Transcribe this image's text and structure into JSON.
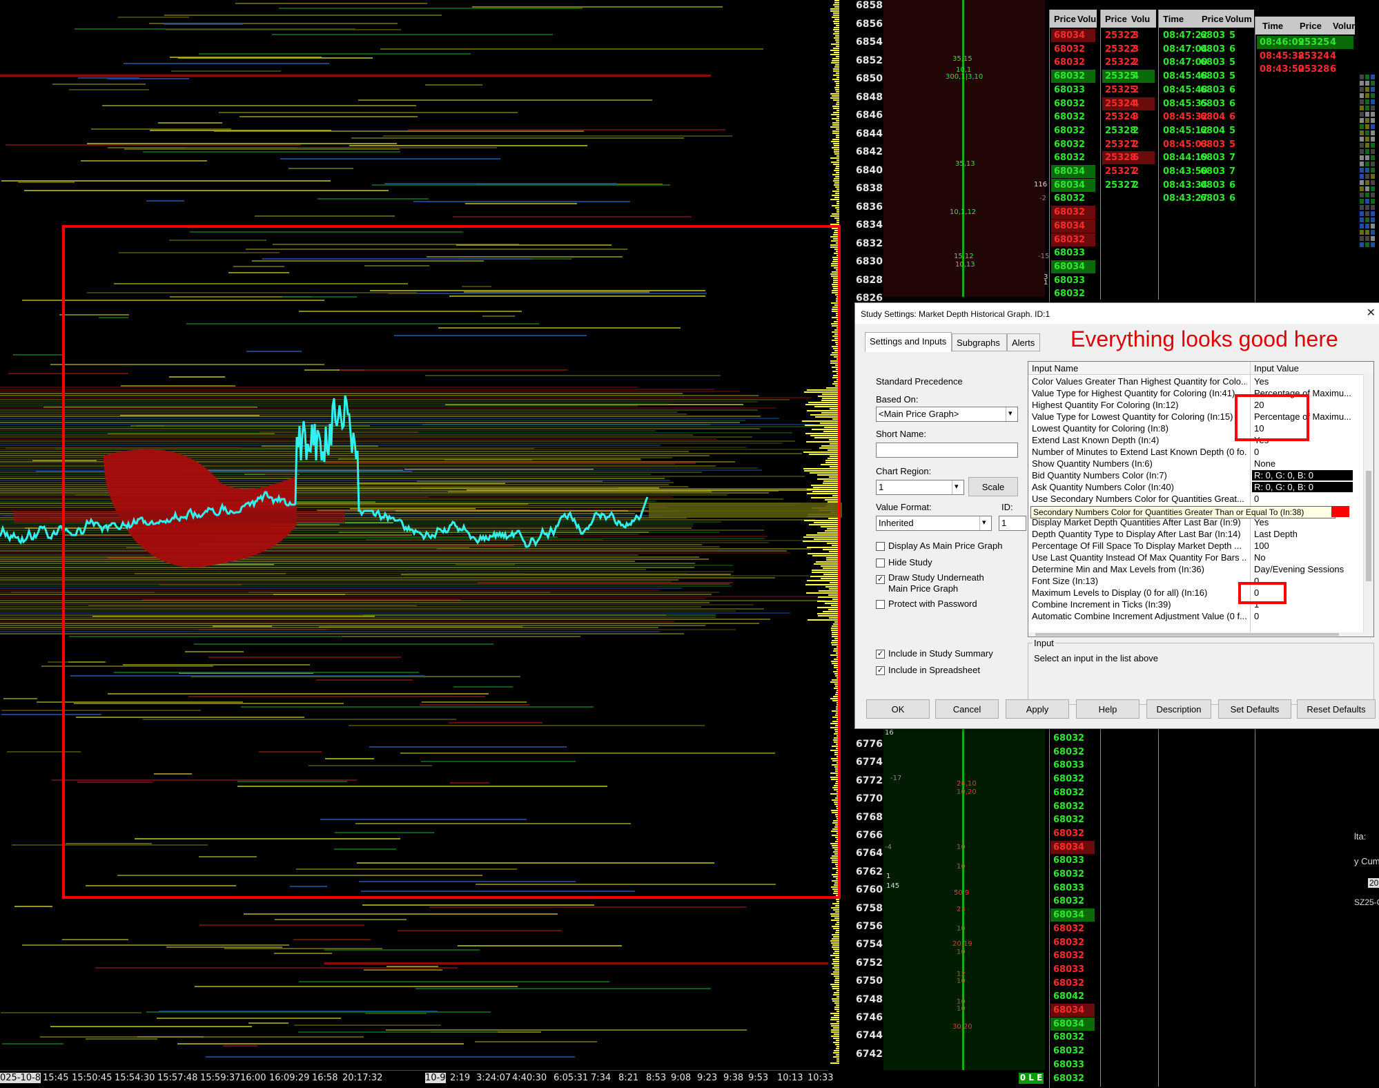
{
  "price_axis": {
    "labels": [
      "6858",
      "6856",
      "6854",
      "6852",
      "6850",
      "6848",
      "6846",
      "6844",
      "6842",
      "6840",
      "6838",
      "6836",
      "6834",
      "6832",
      "6830",
      "6828",
      "6826",
      "6776",
      "6774",
      "6772",
      "6770",
      "6768",
      "6766",
      "6764",
      "6762",
      "6760",
      "6758",
      "6756",
      "6754",
      "6752",
      "6750",
      "6748",
      "6746",
      "6744",
      "6742"
    ]
  },
  "time_axis": {
    "labels": [
      "025-10-8",
      "15:45",
      "15:50:45",
      "15:54:30",
      "15:57:48",
      "15:59:37",
      "16:00",
      "16:09:29",
      "16:58",
      "20:17:32",
      "10-9",
      "2:19",
      "3:24:07",
      "4:40:30",
      "6:05:31",
      "7:34",
      "8:21",
      "8:53",
      "9:08",
      "9:23",
      "9:38",
      "9:53",
      "10:13",
      "10:33"
    ],
    "status": "0 L E"
  },
  "volume_annotations": {
    "items": [
      "35,15",
      "10,1",
      "300,1|3,10",
      "35,13",
      "116",
      "10,1,12",
      "15,12",
      "10,13",
      "-15",
      "3",
      "1",
      "-17",
      "28,10",
      "10,20",
      "16",
      "-4",
      "10",
      "10",
      "50,9",
      "23",
      "10",
      "20,19",
      "10",
      "12",
      "10",
      "10",
      "10",
      "30,20",
      "145",
      "-2",
      "1"
    ]
  },
  "time_and_sales": [
    {
      "headers": [
        "Price",
        "Volu"
      ],
      "rows": [
        {
          "price": "6803",
          "vol": "4",
          "dir": "dn"
        },
        {
          "price": "6803",
          "vol": "2",
          "dir": "dn"
        },
        {
          "price": "6803",
          "vol": "2",
          "dir": "dn"
        },
        {
          "price": "6803",
          "vol": "2",
          "dir": "up"
        },
        {
          "price": "6803",
          "vol": "3",
          "dir": "up"
        },
        {
          "price": "6803",
          "vol": "2",
          "dir": "up"
        },
        {
          "price": "6803",
          "vol": "2",
          "dir": "up"
        },
        {
          "price": "6803",
          "vol": "2",
          "dir": "up"
        },
        {
          "price": "6803",
          "vol": "2",
          "dir": "up"
        },
        {
          "price": "6803",
          "vol": "2",
          "dir": "up"
        },
        {
          "price": "6803",
          "vol": "4",
          "dir": "up"
        },
        {
          "price": "6803",
          "vol": "4",
          "dir": "up"
        },
        {
          "price": "6803",
          "vol": "2",
          "dir": "up"
        },
        {
          "price": "6803",
          "vol": "2",
          "dir": "dn"
        },
        {
          "price": "6803",
          "vol": "4",
          "dir": "dn"
        },
        {
          "price": "6803",
          "vol": "2",
          "dir": "dn"
        },
        {
          "price": "6803",
          "vol": "3",
          "dir": "up"
        },
        {
          "price": "6803",
          "vol": "4",
          "dir": "up"
        },
        {
          "price": "6803",
          "vol": "3",
          "dir": "up"
        },
        {
          "price": "6803",
          "vol": "2",
          "dir": "up"
        }
      ]
    },
    {
      "headers": [
        "Price",
        "Volu"
      ],
      "rows": [
        {
          "price": "25322",
          "vol": "3",
          "dir": "dn"
        },
        {
          "price": "25322",
          "vol": "3",
          "dir": "dn"
        },
        {
          "price": "25322",
          "vol": "2",
          "dir": "dn"
        },
        {
          "price": "25325",
          "vol": "4",
          "dir": "up"
        },
        {
          "price": "25325",
          "vol": "2",
          "dir": "dn"
        },
        {
          "price": "25324",
          "vol": "4",
          "dir": "dn"
        },
        {
          "price": "25324",
          "vol": "3",
          "dir": "dn"
        },
        {
          "price": "25328",
          "vol": "2",
          "dir": "up"
        },
        {
          "price": "25327",
          "vol": "2",
          "dir": "dn"
        },
        {
          "price": "25328",
          "vol": "6",
          "dir": "dn"
        },
        {
          "price": "25327",
          "vol": "2",
          "dir": "dn"
        },
        {
          "price": "25327",
          "vol": "2",
          "dir": "up"
        }
      ]
    },
    {
      "headers": [
        "Time",
        "Price",
        "Volum"
      ],
      "rows": [
        {
          "time": "08:47:22",
          "price": "6803",
          "vol": "5",
          "dir": "up"
        },
        {
          "time": "08:47:04",
          "price": "6803",
          "vol": "6",
          "dir": "up"
        },
        {
          "time": "08:47:00",
          "price": "6803",
          "vol": "5",
          "dir": "up"
        },
        {
          "time": "08:45:48",
          "price": "6803",
          "vol": "5",
          "dir": "up"
        },
        {
          "time": "08:45:48",
          "price": "6803",
          "vol": "6",
          "dir": "up"
        },
        {
          "time": "08:45:35",
          "price": "6803",
          "vol": "6",
          "dir": "up"
        },
        {
          "time": "08:45:32",
          "price": "6804",
          "vol": "6",
          "dir": "dn"
        },
        {
          "time": "08:45:12",
          "price": "6804",
          "vol": "5",
          "dir": "up"
        },
        {
          "time": "08:45:03",
          "price": "6803",
          "vol": "5",
          "dir": "dn"
        },
        {
          "time": "08:44:19",
          "price": "6803",
          "vol": "7",
          "dir": "up"
        },
        {
          "time": "08:43:50",
          "price": "6803",
          "vol": "7",
          "dir": "up"
        },
        {
          "time": "08:43:34",
          "price": "6803",
          "vol": "6",
          "dir": "up"
        },
        {
          "time": "08:43:27",
          "price": "6803",
          "vol": "6",
          "dir": "up"
        }
      ]
    },
    {
      "headers": [
        "Time",
        "Price",
        "Volum"
      ],
      "rows": [
        {
          "time": "08:46:09",
          "price": "25325",
          "vol": "4",
          "dir": "up"
        },
        {
          "time": "08:45:38",
          "price": "25324",
          "vol": "4",
          "dir": "dn"
        },
        {
          "time": "08:43:50",
          "price": "25328",
          "vol": "6",
          "dir": "dn"
        }
      ]
    }
  ],
  "ladder_lower": [
    {
      "price": "6803",
      "vol": "2",
      "dir": "up"
    },
    {
      "price": "6803",
      "vol": "2",
      "dir": "up"
    },
    {
      "price": "6803",
      "vol": "3",
      "dir": "up"
    },
    {
      "price": "6803",
      "vol": "2",
      "dir": "up"
    },
    {
      "price": "6803",
      "vol": "2",
      "dir": "up"
    },
    {
      "price": "6803",
      "vol": "2",
      "dir": "up"
    },
    {
      "price": "6803",
      "vol": "2",
      "dir": "up"
    },
    {
      "price": "6803",
      "vol": "2",
      "dir": "dn"
    },
    {
      "price": "6803",
      "vol": "4",
      "dir": "dn"
    },
    {
      "price": "6803",
      "vol": "3",
      "dir": "up"
    },
    {
      "price": "6803",
      "vol": "2",
      "dir": "up"
    },
    {
      "price": "6803",
      "vol": "3",
      "dir": "up"
    },
    {
      "price": "6803",
      "vol": "2",
      "dir": "up"
    },
    {
      "price": "6803",
      "vol": "4",
      "dir": "up"
    },
    {
      "price": "6803",
      "vol": "2",
      "dir": "dn"
    },
    {
      "price": "6803",
      "vol": "2",
      "dir": "dn"
    },
    {
      "price": "6803",
      "vol": "2",
      "dir": "dn"
    },
    {
      "price": "6803",
      "vol": "3",
      "dir": "dn"
    },
    {
      "price": "6803",
      "vol": "2",
      "dir": "dn"
    },
    {
      "price": "6804",
      "vol": "2",
      "dir": "up"
    },
    {
      "price": "6803",
      "vol": "4",
      "dir": "dn"
    },
    {
      "price": "6803",
      "vol": "4",
      "dir": "up"
    },
    {
      "price": "6803",
      "vol": "2",
      "dir": "up"
    },
    {
      "price": "6803",
      "vol": "2",
      "dir": "up"
    },
    {
      "price": "6803",
      "vol": "3",
      "dir": "up"
    },
    {
      "price": "6803",
      "vol": "2",
      "dir": "up"
    }
  ],
  "side_fragments": {
    "a": "lta:",
    "b": "y Cum",
    "c": "20",
    "d": "SZ25-C"
  },
  "dialog": {
    "title": "Study Settings: Market Depth Historical Graph. ID:1",
    "close": "✕",
    "tabs": [
      "Settings and Inputs",
      "Subgraphs",
      "Alerts"
    ],
    "annotation": "Everything looks good here",
    "standard_precedence": "Standard Precedence",
    "based_on_label": "Based On:",
    "based_on_value": "<Main Price Graph>",
    "short_name_label": "Short Name:",
    "short_name_value": "",
    "chart_region_label": "Chart Region:",
    "chart_region_value": "1",
    "scale_button": "Scale",
    "value_format_label": "Value Format:",
    "value_format_value": "Inherited",
    "id_label": "ID:",
    "id_value": "1",
    "checkboxes": [
      {
        "label": "Display As Main Price Graph",
        "checked": false
      },
      {
        "label": "Hide Study",
        "checked": false
      },
      {
        "label": "Draw Study Underneath",
        "label2": "Main Price Graph",
        "checked": true
      },
      {
        "label": "Protect with Password",
        "checked": false
      }
    ],
    "summary_checkboxes": [
      {
        "label": "Include in Study Summary",
        "checked": true
      },
      {
        "label": "Include in Spreadsheet",
        "checked": true
      }
    ],
    "grid_headers": [
      "Input Name",
      "Input Value"
    ],
    "inputs": [
      {
        "name": "Color Values Greater Than Highest Quantity for Colo...",
        "value": "Yes"
      },
      {
        "name": "Value Type for Highest Quantity for Coloring  (In:41)",
        "value": "Percentage of Maximu..."
      },
      {
        "name": "Highest Quantity For Coloring  (In:12)",
        "value": "20"
      },
      {
        "name": "Value Type for Lowest Quantity for Coloring  (In:15)",
        "value": "Percentage of Maximu..."
      },
      {
        "name": "Lowest Quantity for Coloring  (In:8)",
        "value": "10"
      },
      {
        "name": "Extend Last Known Depth  (In:4)",
        "value": "Yes"
      },
      {
        "name": "Number of Minutes to Extend Last Known Depth (0 fo...",
        "value": "0"
      },
      {
        "name": "Show Quantity Numbers  (In:6)",
        "value": "None"
      },
      {
        "name": "Bid Quantity Numbers Color  (In:7)",
        "value": "R: 0, G: 0, B: 0",
        "dark": true
      },
      {
        "name": "Ask Quantity Numbers Color  (In:40)",
        "value": "R: 0, G: 0, B: 0",
        "dark": true
      },
      {
        "name": "Use Secondary Numbers Color for Quantities Great...",
        "value": "0"
      },
      {
        "name": "Secondary Numbers Color for Quantities Greater Than or Equal To  (In:38)",
        "value": ""
      },
      {
        "name": "Display Market Depth Quantities After Last Bar  (In:9)",
        "value": "Yes"
      },
      {
        "name": "Depth Quantity Type to Display After Last Bar  (In:14)",
        "value": "Last Depth"
      },
      {
        "name": "Percentage Of Fill Space To Display Market Depth ...",
        "value": "100"
      },
      {
        "name": "Use Last Quantity Instead Of Max Quantity For Bars ...",
        "value": "No"
      },
      {
        "name": "Determine Min and Max Levels from  (In:36)",
        "value": "Day/Evening Sessions"
      },
      {
        "name": "Font Size  (In:13)",
        "value": "0"
      },
      {
        "name": "Maximum Levels to Display (0 for all)  (In:16)",
        "value": "0"
      },
      {
        "name": "Combine Increment in Ticks  (In:39)",
        "value": "1"
      },
      {
        "name": "Automatic Combine Increment Adjustment Value (0 f...",
        "value": "0"
      }
    ],
    "tooltip": "Secondary Numbers Color for Quantities Greater Than or Equal To  (In:38)",
    "input_group_label": "Input",
    "input_hint": "Select an input in the list above",
    "buttons": [
      "OK",
      "Cancel",
      "Apply",
      "Help",
      "Description",
      "Set Defaults",
      "Reset Defaults"
    ]
  },
  "colors": {
    "price_line": "#33f0f0",
    "highlight_box": "#ff0000",
    "up": "#2ee62e",
    "down": "#ff2b2b",
    "axis_bar": "#ffff30"
  }
}
